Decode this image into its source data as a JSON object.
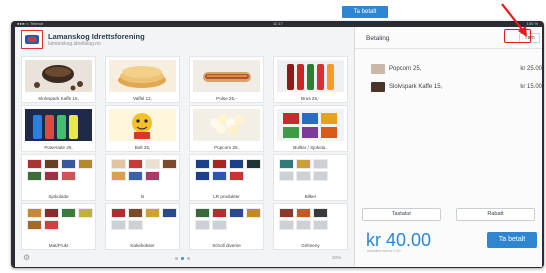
{
  "top_button": {
    "label": "Ta betalt"
  },
  "statusbar": {
    "carrier": "●●●○○ Telenor",
    "clock": "11:17",
    "battery": "100 %"
  },
  "brand": {
    "title": "Lamanskog Idrettsforening",
    "subtitle": "lamanskog.idrettslag.no"
  },
  "products": [
    {
      "caption": "Slolvspark Kaffe 15,",
      "icon": "coffee-image"
    },
    {
      "caption": "Vaffel 12,",
      "icon": "waffle-image"
    },
    {
      "caption": "Polse 25,-",
      "icon": "hotdog-image"
    },
    {
      "caption": "Brus 25,-",
      "icon": "soda-image"
    },
    {
      "caption": "Powerade 25,",
      "icon": "sports-drink-image"
    },
    {
      "caption": "Bolt 25,",
      "icon": "mascot-image"
    },
    {
      "caption": "Popcorn 25,",
      "icon": "popcorn-image"
    },
    {
      "caption": "Bulltar / Sjokola..",
      "icon": "snacks-image"
    }
  ],
  "categories": [
    {
      "caption": "Sjokolade"
    },
    {
      "caption": "Is"
    },
    {
      "caption": "LR produkter"
    },
    {
      "caption": "Bilker"
    },
    {
      "caption": "Mat/Frukt"
    },
    {
      "caption": "Kakebokser"
    },
    {
      "caption": "Scholl diverse"
    },
    {
      "caption": "Grilmeny"
    }
  ],
  "pager": {
    "percent": "20%"
  },
  "cart": {
    "title": "Betaling",
    "clear_label": "Tøm",
    "lines": [
      {
        "name": "Popcorn 25,",
        "price": "kr 25.00"
      },
      {
        "name": "Slolvspark Kaffe 15,",
        "price": "kr 15.00"
      }
    ],
    "keyboard_label": "Tastatur",
    "discount_label": "Rabatt",
    "total": "kr 40.00",
    "total_sub": "Inkludert mva kr 0.00",
    "pay_label": "Ta betalt"
  },
  "colors": {
    "accent": "#2e86d0",
    "annotation": "#e31b1b"
  }
}
